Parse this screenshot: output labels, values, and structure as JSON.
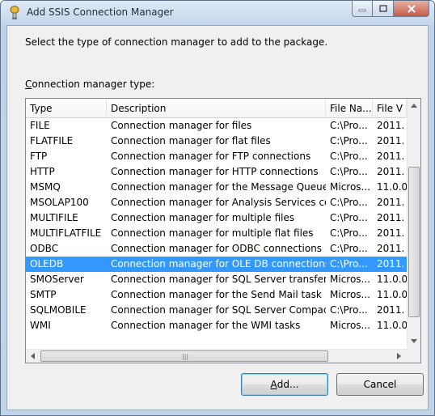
{
  "window": {
    "title": "Add SSIS Connection Manager"
  },
  "prompt": "Select the type of connection manager to add to the package.",
  "list_label": {
    "accel": "C",
    "rest": "onnection manager type:"
  },
  "columns": [
    "Type",
    "Description",
    "File Na...",
    "File V"
  ],
  "rows": [
    {
      "type": "FILE",
      "description": "Connection manager for files",
      "file": "C:\\Pro...",
      "version": "2011."
    },
    {
      "type": "FLATFILE",
      "description": "Connection manager for flat files",
      "file": "C:\\Pro...",
      "version": "2011."
    },
    {
      "type": "FTP",
      "description": "Connection manager for FTP connections",
      "file": "C:\\Pro...",
      "version": "2011."
    },
    {
      "type": "HTTP",
      "description": "Connection manager for HTTP connections",
      "file": "C:\\Pro...",
      "version": "2011."
    },
    {
      "type": "MSMQ",
      "description": "Connection manager for the Message Queue t...",
      "file": "Micros...",
      "version": "11.0.0"
    },
    {
      "type": "MSOLAP100",
      "description": "Connection manager for Analysis Services con...",
      "file": "C:\\Pro...",
      "version": "2011."
    },
    {
      "type": "MULTIFILE",
      "description": "Connection manager for multiple files",
      "file": "C:\\Pro...",
      "version": "2011."
    },
    {
      "type": "MULTIFLATFILE",
      "description": "Connection manager for multiple flat files",
      "file": "C:\\Pro...",
      "version": "2011."
    },
    {
      "type": "ODBC",
      "description": "Connection manager for ODBC connections",
      "file": "C:\\Pro...",
      "version": "2011."
    },
    {
      "type": "OLEDB",
      "description": "Connection manager for OLE DB connections",
      "file": "C:\\Pro...",
      "version": "2011."
    },
    {
      "type": "SMOServer",
      "description": "Connection manager for SQL Server transfer ta...",
      "file": "Micros...",
      "version": "11.0.0"
    },
    {
      "type": "SMTP",
      "description": "Connection manager for the Send Mail task",
      "file": "Micros...",
      "version": "11.0.0"
    },
    {
      "type": "SQLMOBILE",
      "description": "Connection manager for SQL Server Compact ...",
      "file": "C:\\Pro...",
      "version": "2011."
    },
    {
      "type": "WMI",
      "description": "Connection manager for the WMI tasks",
      "file": "Micros...",
      "version": "11.0.0"
    }
  ],
  "selected_row": "OLEDB",
  "buttons": {
    "add_accel": "A",
    "add_rest": "dd...",
    "cancel": "Cancel"
  },
  "colors": {
    "selection": "#3399ff",
    "window_frame": "#bfd3e9"
  },
  "icons": {
    "title": "ssis-connection-icon",
    "minimize": "minimize-icon",
    "maximize": "maximize-icon",
    "close": "close-icon"
  }
}
